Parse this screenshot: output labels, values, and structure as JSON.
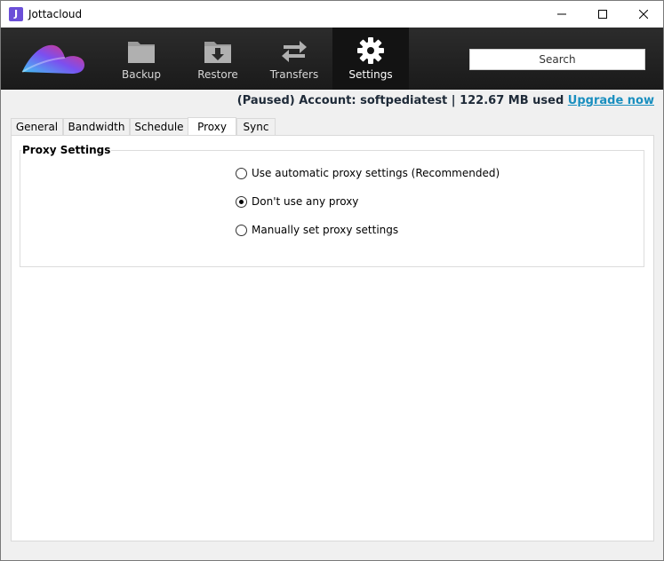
{
  "window": {
    "title": "Jottacloud",
    "icon_letter": "J"
  },
  "toolbar": {
    "nav": [
      {
        "label": "Backup",
        "icon": "folder-icon"
      },
      {
        "label": "Restore",
        "icon": "download-icon"
      },
      {
        "label": "Transfers",
        "icon": "transfer-arrows-icon"
      },
      {
        "label": "Settings",
        "icon": "gear-icon",
        "active": true
      }
    ],
    "search_label": "Search"
  },
  "status": {
    "text": "(Paused) Account: softpediatest  |  122.67 MB used",
    "upgrade_link": "Upgrade now"
  },
  "tabs": [
    {
      "label": "General"
    },
    {
      "label": "Bandwidth"
    },
    {
      "label": "Schedule"
    },
    {
      "label": "Proxy",
      "selected": true
    },
    {
      "label": "Sync"
    }
  ],
  "proxy": {
    "group_title": "Proxy Settings",
    "options": [
      {
        "label": "Use automatic proxy settings (Recommended)",
        "checked": false
      },
      {
        "label": "Don't use any proxy",
        "checked": true
      },
      {
        "label": "Manually set proxy settings",
        "checked": false
      }
    ]
  },
  "colors": {
    "toolbar_bg": "#222222",
    "active_nav_bg": "#131313",
    "link": "#1a8fbf",
    "logo_purple": "#7b4ff0",
    "logo_pink": "#f0306a",
    "logo_cyan": "#3fc6f2"
  }
}
